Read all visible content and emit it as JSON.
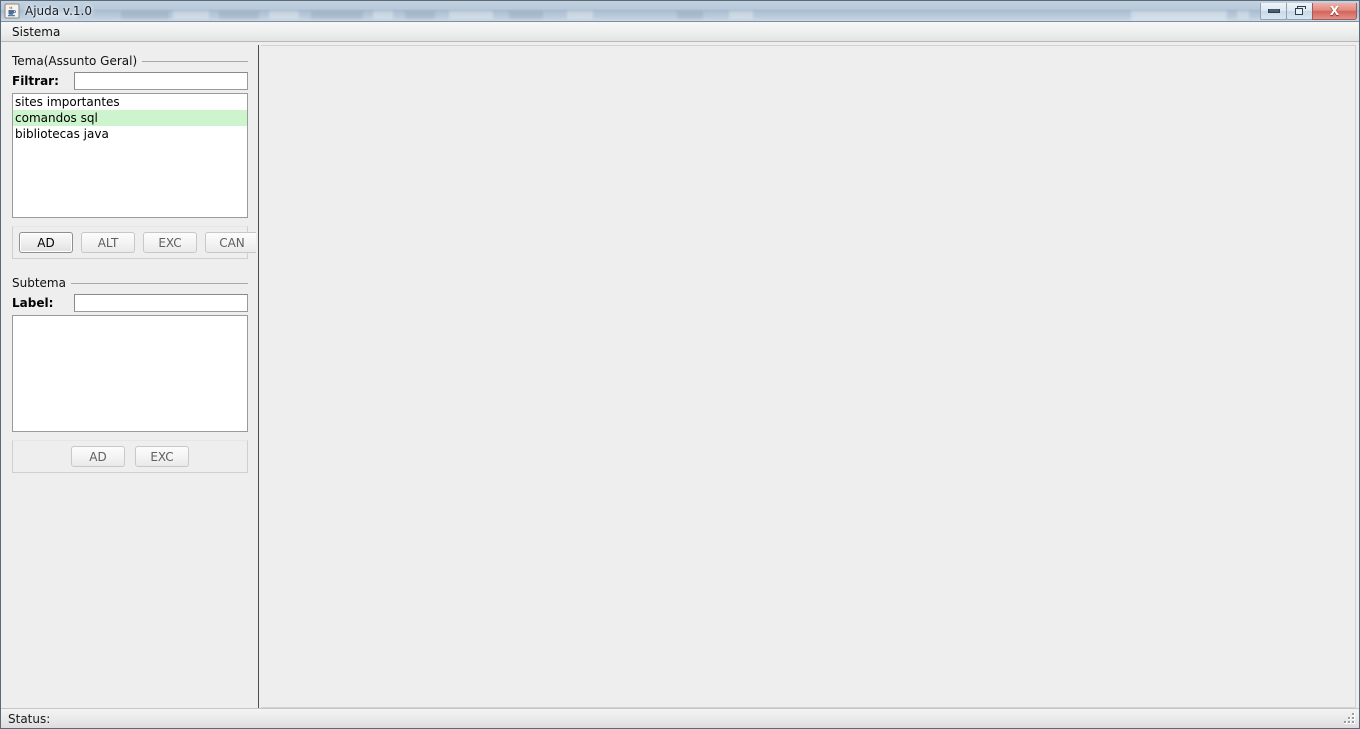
{
  "window": {
    "title": "Ajuda v.1.0",
    "app_icon": "java-coffee-cup-icon",
    "controls": {
      "minimize": "minimize-icon",
      "restore": "restore-icon",
      "close": "X"
    }
  },
  "menubar": {
    "items": [
      {
        "label": "Sistema"
      }
    ]
  },
  "tema_group": {
    "title": "Tema(Assunto Geral)",
    "filter_label": "Filtrar:",
    "filter_value": "",
    "filter_placeholder": "",
    "list_items": [
      {
        "label": "sites importantes",
        "selected": false
      },
      {
        "label": "comandos sql",
        "selected": true
      },
      {
        "label": "bibliotecas java",
        "selected": false
      }
    ],
    "selection_color": "#cdf5cd",
    "buttons": [
      {
        "label": "AD",
        "enabled": true
      },
      {
        "label": "ALT",
        "enabled": false
      },
      {
        "label": "EXC",
        "enabled": false
      },
      {
        "label": "CAN",
        "enabled": false
      }
    ]
  },
  "subtema_group": {
    "title": "Subtema",
    "label_label": "Label:",
    "label_value": "",
    "label_placeholder": "",
    "textarea_value": "",
    "buttons": [
      {
        "label": "AD",
        "enabled": false
      },
      {
        "label": "EXC",
        "enabled": false
      }
    ]
  },
  "statusbar": {
    "label": "Status:"
  }
}
